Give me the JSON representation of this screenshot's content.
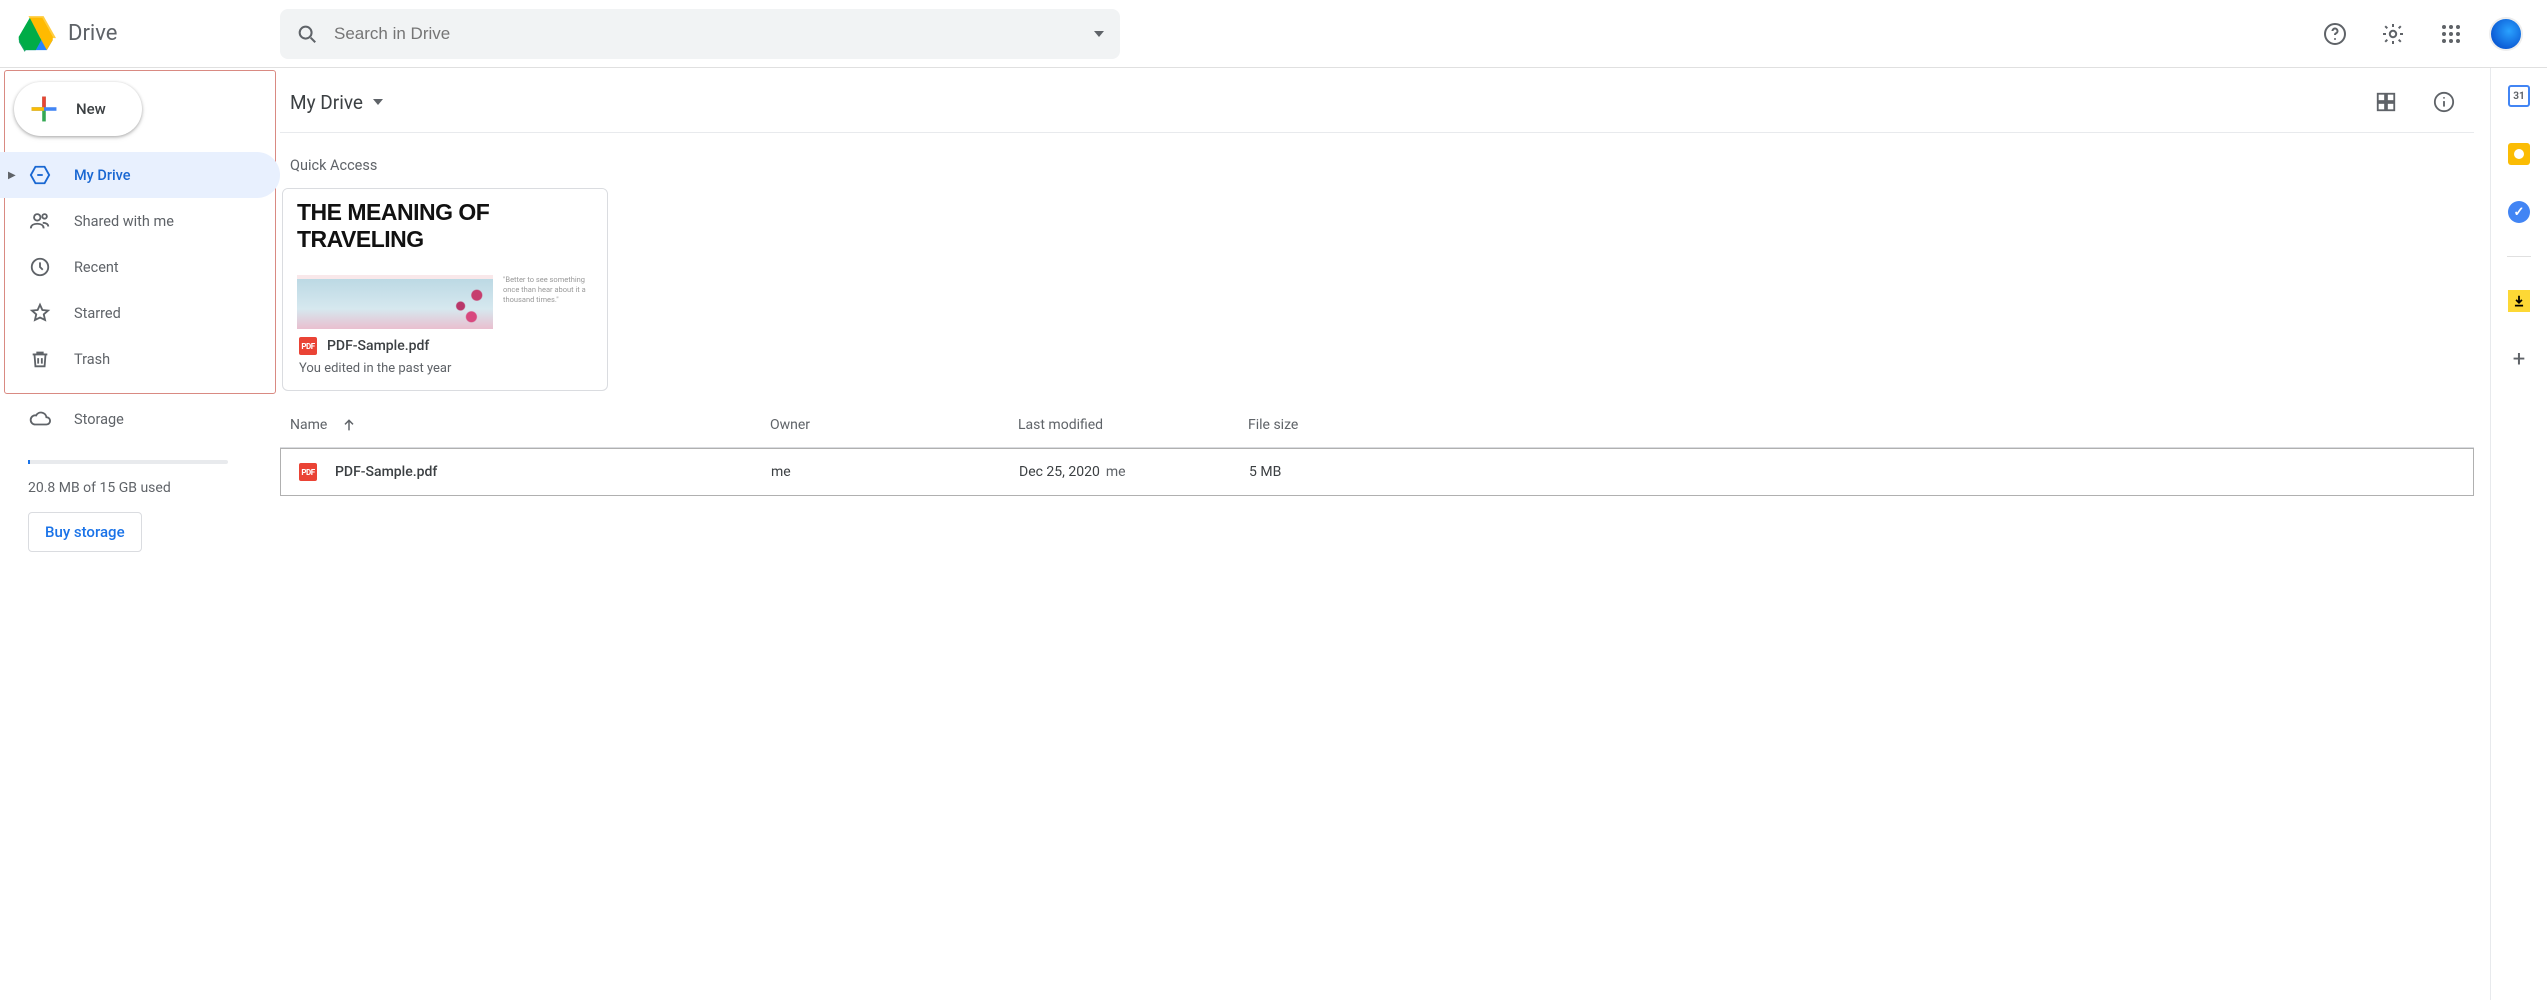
{
  "app_name": "Drive",
  "search": {
    "placeholder": "Search in Drive"
  },
  "sidebar": {
    "new_label": "New",
    "items": [
      {
        "label": "My Drive"
      },
      {
        "label": "Shared with me"
      },
      {
        "label": "Recent"
      },
      {
        "label": "Starred"
      },
      {
        "label": "Trash"
      }
    ],
    "storage": {
      "label": "Storage",
      "usage_text": "20.8 MB of 15 GB used",
      "buy_label": "Buy storage"
    }
  },
  "main": {
    "breadcrumb": "My Drive",
    "quick_access_title": "Quick Access",
    "quick_card": {
      "preview_headline": "THE MEANING OF TRAVELING",
      "preview_quote": "\"Better to see something once than hear about it a thousand times.\"",
      "file_name": "PDF-Sample.pdf",
      "subtitle": "You edited in the past year",
      "pdf_badge": "PDF"
    },
    "columns": {
      "name": "Name",
      "owner": "Owner",
      "modified": "Last modified",
      "size": "File size"
    },
    "rows": [
      {
        "name": "PDF-Sample.pdf",
        "owner": "me",
        "modified": "Dec 25, 2020",
        "modified_by": "me",
        "size": "5 MB",
        "badge": "PDF"
      }
    ]
  },
  "icons": {
    "search": "search-icon",
    "options": "options-caret-icon",
    "help": "help-icon",
    "settings": "gear-icon",
    "apps": "apps-grid-icon",
    "grid_view": "grid-view-icon",
    "info": "info-icon",
    "sort_arrow": "arrow-up-icon",
    "calendar": "calendar-icon",
    "keep": "keep-icon",
    "tasks": "tasks-icon",
    "download": "download-icon",
    "add": "plus-icon"
  }
}
